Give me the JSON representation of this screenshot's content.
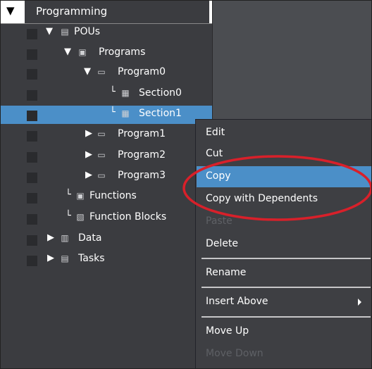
{
  "tree": {
    "header": {
      "label": "Programming"
    },
    "rows": [
      {
        "label": "POUs",
        "icon": "pou-icon",
        "expander": "expanded"
      },
      {
        "label": "Programs",
        "icon": "programs-icon",
        "expander": "expanded"
      },
      {
        "label": "Program0",
        "icon": "program-icon",
        "expander": "expanded"
      },
      {
        "label": "Section0",
        "icon": "section-icon",
        "expander": "leaf"
      },
      {
        "label": "Section1",
        "icon": "section-icon",
        "expander": "leaf",
        "selected": true
      },
      {
        "label": "Program1",
        "icon": "program-icon",
        "expander": "collapsed"
      },
      {
        "label": "Program2",
        "icon": "program-icon",
        "expander": "collapsed"
      },
      {
        "label": "Program3",
        "icon": "program-icon",
        "expander": "collapsed"
      },
      {
        "label": "Functions",
        "icon": "functions-icon",
        "expander": "leaf"
      },
      {
        "label": "Function Blocks",
        "icon": "function-blocks-icon",
        "expander": "leaf"
      },
      {
        "label": "Data",
        "icon": "data-icon",
        "expander": "collapsed"
      },
      {
        "label": "Tasks",
        "icon": "tasks-icon",
        "expander": "collapsed"
      }
    ]
  },
  "context_menu": {
    "items": [
      {
        "label": "Edit",
        "enabled": true
      },
      {
        "label": "Cut",
        "enabled": true
      },
      {
        "label": "Copy",
        "enabled": true,
        "highlighted": true
      },
      {
        "label": "Copy with Dependents",
        "enabled": true
      },
      {
        "label": "Paste",
        "enabled": false
      },
      {
        "label": "Delete",
        "enabled": true
      },
      {
        "label": "Rename",
        "enabled": true
      },
      {
        "label": "Insert Above",
        "enabled": true,
        "submenu": true
      },
      {
        "label": "Move Up",
        "enabled": true
      },
      {
        "label": "Move Down",
        "enabled": false
      }
    ]
  },
  "annotation": {
    "type": "ellipse",
    "color": "#d8202a",
    "highlights": [
      "Copy",
      "Copy with Dependents"
    ]
  },
  "colors": {
    "selection": "#4b8fc8",
    "tree_bg": "#3b3c40",
    "menu_bg": "#3e3f43"
  }
}
